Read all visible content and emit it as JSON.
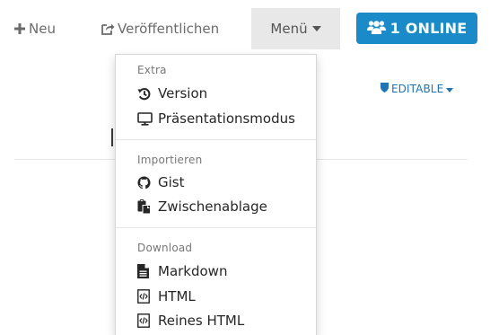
{
  "nav": {
    "new_label": "Neu",
    "publish_label": "Veröffentlichen",
    "menu_label": "Menü",
    "online_label": "1 ONLINE"
  },
  "editor": {
    "permission_label": "EDITABLE"
  },
  "menu": {
    "extra": {
      "header": "Extra",
      "items": [
        {
          "label": "Version",
          "icon": "history-icon"
        },
        {
          "label": "Präsentationsmodus",
          "icon": "monitor-icon"
        }
      ]
    },
    "import": {
      "header": "Importieren",
      "items": [
        {
          "label": "Gist",
          "icon": "github-icon"
        },
        {
          "label": "Zwischenablage",
          "icon": "paste-icon"
        }
      ]
    },
    "download": {
      "header": "Download",
      "items": [
        {
          "label": "Markdown",
          "icon": "file-text-icon"
        },
        {
          "label": "HTML",
          "icon": "html5-file-icon"
        },
        {
          "label": "Reines HTML",
          "icon": "html5-file-icon"
        }
      ]
    }
  },
  "colors": {
    "accent": "#1a8ac9",
    "editable": "#1f74b6",
    "menu_active_bg": "#e8e8e8"
  }
}
